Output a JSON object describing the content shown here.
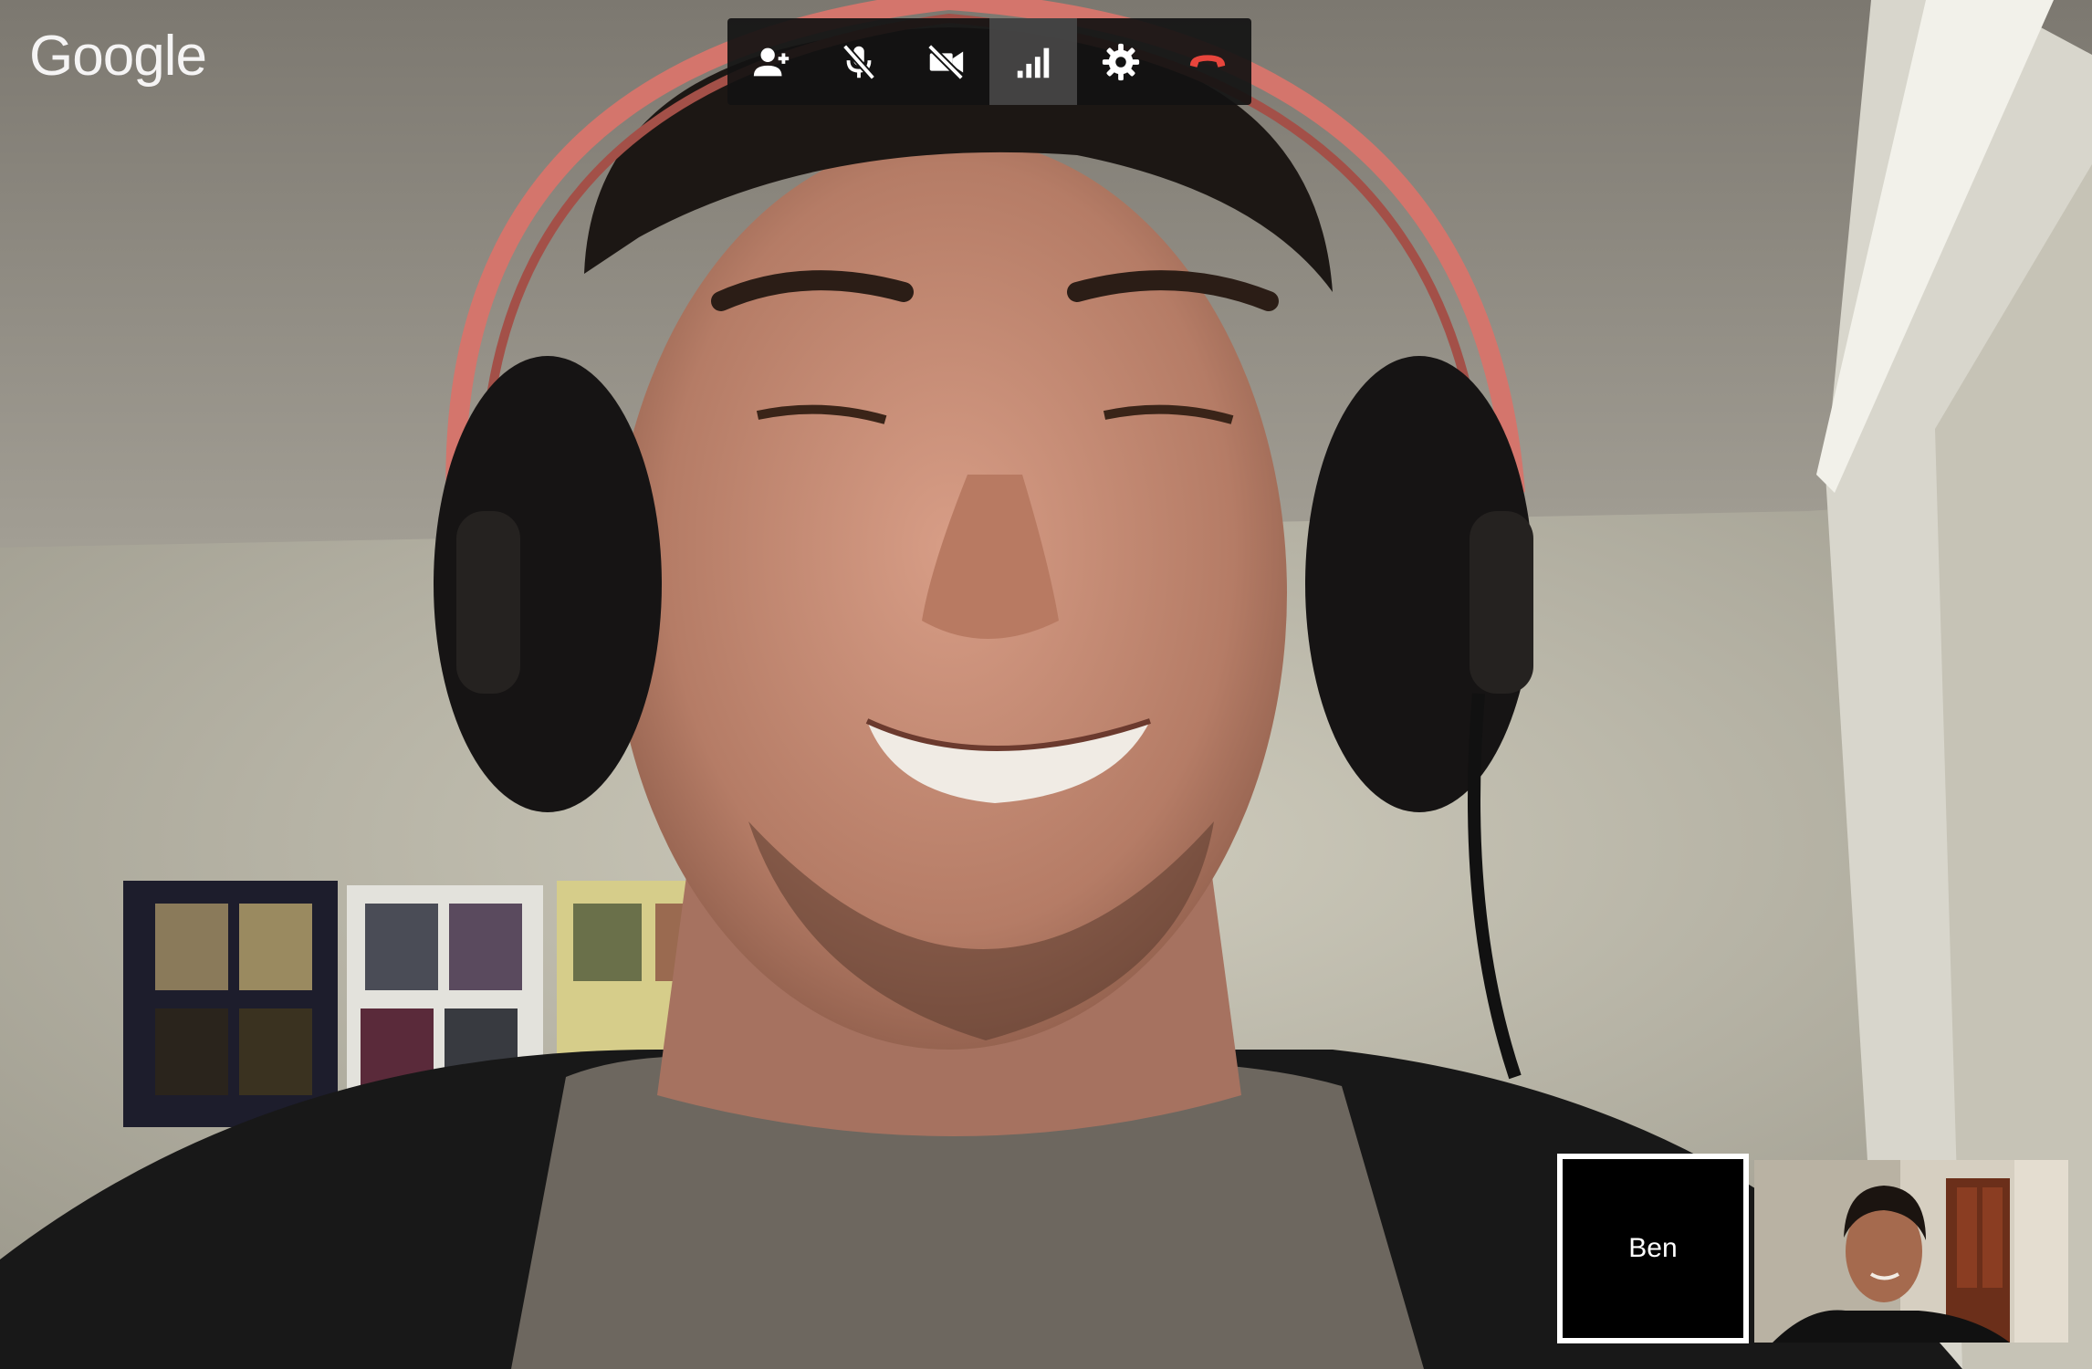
{
  "logo": {
    "text": "Google"
  },
  "toolbar": {
    "buttons": [
      {
        "name": "add-person",
        "icon": "person-add-icon",
        "color": "#ffffff"
      },
      {
        "name": "mute-mic",
        "icon": "mic-off-icon",
        "color": "#ffffff"
      },
      {
        "name": "camera-off",
        "icon": "videocam-off-icon",
        "color": "#ffffff"
      },
      {
        "name": "bandwidth",
        "icon": "signal-bars-icon",
        "color": "#ffffff"
      },
      {
        "name": "settings",
        "icon": "gear-icon",
        "color": "#ffffff"
      },
      {
        "name": "hang-up",
        "icon": "hang-up-icon",
        "color": "#e8453c"
      }
    ]
  },
  "participants": {
    "thumbnail_label": "Ben"
  },
  "colors": {
    "toolbar_bg": "#121212",
    "hangup_red": "#e8453c",
    "selected_border": "#ffffff"
  }
}
